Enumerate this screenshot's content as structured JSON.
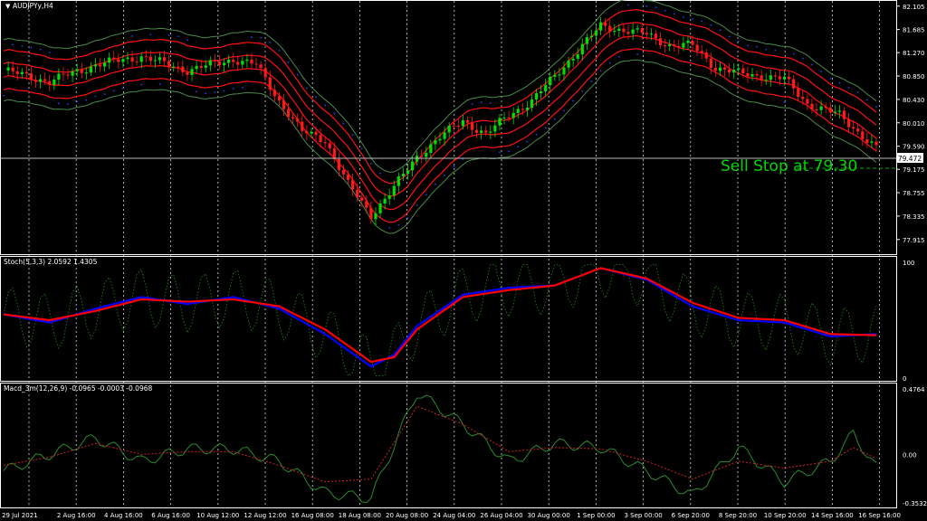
{
  "window": {
    "symbol_title": "AUDJPYy,H4"
  },
  "indicators": {
    "stoch": {
      "label": "Stoch(5,3,3) 2.0592 1.4305"
    },
    "macd": {
      "label": "Macd_3m(12,26,9) -0.0965 -0.0003 -0.0968"
    }
  },
  "annotation": {
    "text": "Sell Stop at 79.30"
  },
  "colors": {
    "background": "#000000",
    "frame": "#ffffff",
    "grid": "#ffffff",
    "bull_candle": "#00e000",
    "bear_candle": "#ff1a1a",
    "envelope": "#ff1010",
    "bollinger": "#4a8a4a",
    "dots": "#2040ff",
    "stoch_main": "#0000ff",
    "stoch_signal": "#ff0000",
    "stoch_fast": "#1f7a1f",
    "macd_main": "#2a8a2a",
    "macd_signal": "#cc2222",
    "annotation": "#00d800"
  },
  "chart_data": [
    {
      "type": "candlestick",
      "title": "AUDJPYy,H4",
      "price_ticks": [
        "82.105",
        "81.685",
        "81.270",
        "80.850",
        "80.430",
        "80.010",
        "79.590",
        "79.175",
        "78.755",
        "78.335",
        "77.915"
      ],
      "ylim": [
        77.7,
        82.15
      ],
      "current_price": "79.472",
      "sell_stop": 79.3,
      "x_ticks": [
        "29 Jul 2021",
        "2 Aug 16:00",
        "4 Aug 16:00",
        "6 Aug 16:00",
        "10 Aug 12:00",
        "12 Aug 12:00",
        "16 Aug 08:00",
        "18 Aug 08:00",
        "20 Aug 08:00",
        "24 Aug 04:00",
        "26 Aug 04:00",
        "30 Aug 00:00",
        "1 Sep 00:00",
        "3 Sep 00:00",
        "6 Sep 20:00",
        "8 Sep 20:00",
        "10 Sep 20:00",
        "14 Sep 16:00",
        "16 Sep 16:00"
      ],
      "close_path": [
        [
          0,
          80.95
        ],
        [
          10,
          80.75
        ],
        [
          20,
          81.05
        ],
        [
          30,
          81.2
        ],
        [
          40,
          80.95
        ],
        [
          50,
          81.15
        ],
        [
          55,
          81.05
        ],
        [
          60,
          80.4
        ],
        [
          65,
          79.85
        ],
        [
          70,
          79.7
        ],
        [
          75,
          78.9
        ],
        [
          80,
          78.35
        ],
        [
          85,
          78.85
        ],
        [
          90,
          79.4
        ],
        [
          95,
          79.75
        ],
        [
          100,
          80.05
        ],
        [
          105,
          79.8
        ],
        [
          110,
          80.15
        ],
        [
          115,
          80.4
        ],
        [
          120,
          80.85
        ],
        [
          125,
          81.3
        ],
        [
          130,
          81.75
        ],
        [
          140,
          81.6
        ],
        [
          145,
          81.4
        ],
        [
          150,
          81.4
        ],
        [
          155,
          81.0
        ],
        [
          160,
          80.9
        ],
        [
          170,
          80.8
        ],
        [
          175,
          80.35
        ],
        [
          182,
          80.15
        ],
        [
          190,
          79.55
        ]
      ]
    },
    {
      "type": "line",
      "title": "Stoch(5,3,3) 2.0592 1.4305",
      "yticks": [
        "100",
        "0"
      ],
      "ylim": [
        0,
        100
      ],
      "series": [
        {
          "values_path": [
            [
              0,
              55
            ],
            [
              10,
              48
            ],
            [
              20,
              60
            ],
            [
              30,
              70
            ],
            [
              40,
              64
            ],
            [
              50,
              70
            ],
            [
              60,
              60
            ],
            [
              70,
              38
            ],
            [
              80,
              10
            ],
            [
              85,
              20
            ],
            [
              90,
              45
            ],
            [
              100,
              72
            ],
            [
              110,
              78
            ],
            [
              120,
              80
            ],
            [
              130,
              95
            ],
            [
              140,
              85
            ],
            [
              150,
              62
            ],
            [
              160,
              50
            ],
            [
              170,
              48
            ],
            [
              180,
              36
            ],
            [
              190,
              38
            ]
          ]
        },
        {
          "values_path": [
            [
              0,
              55
            ],
            [
              10,
              50
            ],
            [
              20,
              58
            ],
            [
              30,
              68
            ],
            [
              40,
              66
            ],
            [
              50,
              68
            ],
            [
              60,
              62
            ],
            [
              70,
              42
            ],
            [
              80,
              14
            ],
            [
              85,
              18
            ],
            [
              90,
              42
            ],
            [
              100,
              70
            ],
            [
              110,
              76
            ],
            [
              120,
              80
            ],
            [
              130,
              95
            ],
            [
              140,
              86
            ],
            [
              150,
              65
            ],
            [
              160,
              52
            ],
            [
              170,
              50
            ],
            [
              180,
              38
            ],
            [
              190,
              37
            ]
          ]
        }
      ]
    },
    {
      "type": "line",
      "title": "Macd_3m(12,26,9) -0.0965 -0.0003 -0.0968",
      "yticks": [
        "0.4764",
        "0.00",
        "-0.3532"
      ],
      "ylim": [
        -0.3532,
        0.4764
      ],
      "series": [
        {
          "values_path": [
            [
              0,
              -0.12
            ],
            [
              10,
              0.0
            ],
            [
              20,
              0.12
            ],
            [
              30,
              -0.05
            ],
            [
              40,
              0.04
            ],
            [
              50,
              0.04
            ],
            [
              60,
              -0.05
            ],
            [
              70,
              -0.28
            ],
            [
              80,
              -0.32
            ],
            [
              90,
              0.45
            ],
            [
              100,
              0.22
            ],
            [
              110,
              -0.05
            ],
            [
              120,
              0.08
            ],
            [
              130,
              0.05
            ],
            [
              140,
              -0.12
            ],
            [
              150,
              -0.3
            ],
            [
              160,
              0.05
            ],
            [
              170,
              -0.2
            ],
            [
              180,
              -0.05
            ],
            [
              185,
              0.15
            ],
            [
              190,
              -0.1
            ]
          ]
        },
        {
          "values_path": [
            [
              0,
              -0.08
            ],
            [
              10,
              -0.02
            ],
            [
              20,
              0.08
            ],
            [
              30,
              0.0
            ],
            [
              40,
              0.02
            ],
            [
              50,
              0.02
            ],
            [
              60,
              -0.08
            ],
            [
              70,
              -0.2
            ],
            [
              80,
              -0.18
            ],
            [
              90,
              0.35
            ],
            [
              100,
              0.22
            ],
            [
              110,
              0.02
            ],
            [
              120,
              0.05
            ],
            [
              130,
              0.04
            ],
            [
              140,
              -0.05
            ],
            [
              150,
              -0.18
            ],
            [
              160,
              -0.05
            ],
            [
              170,
              -0.1
            ],
            [
              180,
              -0.05
            ],
            [
              185,
              0.05
            ],
            [
              190,
              -0.03
            ]
          ]
        }
      ]
    }
  ]
}
